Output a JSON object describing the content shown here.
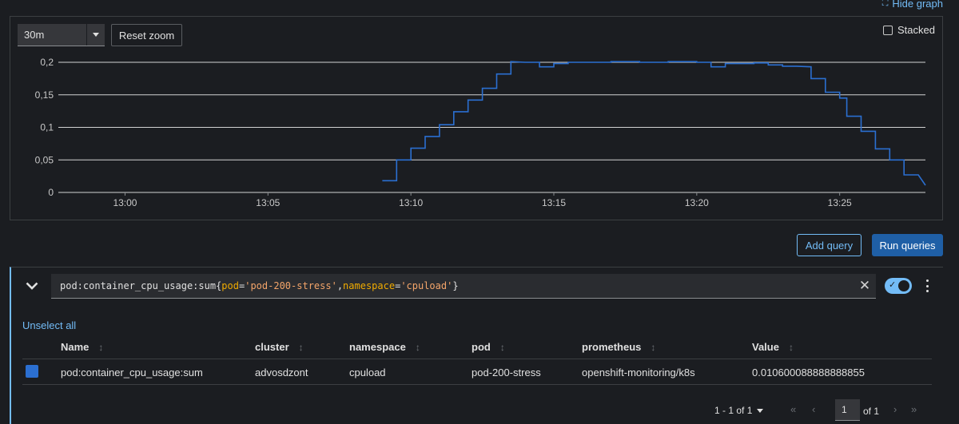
{
  "header": {
    "hide_graph_label": "Hide graph"
  },
  "graph_controls": {
    "time_span": "30m",
    "reset_zoom_label": "Reset zoom",
    "stacked_label": "Stacked",
    "stacked_checked": false
  },
  "chart_data": {
    "type": "line",
    "y_ticks": [
      "0,2",
      "0,15",
      "0,1",
      "0,05",
      "0"
    ],
    "x_ticks": [
      "13:00",
      "13:05",
      "13:10",
      "13:15",
      "13:20",
      "13:25"
    ],
    "ylim": [
      0,
      0.2
    ],
    "xlim_minutes": [
      "12:57:40",
      "13:28:00"
    ],
    "grid": true,
    "series": [
      {
        "color": "#2b6fd1",
        "points": [
          [
            "13:09:00",
            0.018
          ],
          [
            "13:09:30",
            0.018
          ],
          [
            "13:09:30",
            0.05
          ],
          [
            "13:10:00",
            0.05
          ],
          [
            "13:10:00",
            0.068
          ],
          [
            "13:10:30",
            0.068
          ],
          [
            "13:10:30",
            0.086
          ],
          [
            "13:11:00",
            0.086
          ],
          [
            "13:11:00",
            0.104
          ],
          [
            "13:11:30",
            0.104
          ],
          [
            "13:11:30",
            0.124
          ],
          [
            "13:12:00",
            0.124
          ],
          [
            "13:12:00",
            0.142
          ],
          [
            "13:12:30",
            0.142
          ],
          [
            "13:12:30",
            0.16
          ],
          [
            "13:13:00",
            0.16
          ],
          [
            "13:13:00",
            0.182
          ],
          [
            "13:13:30",
            0.182
          ],
          [
            "13:13:30",
            0.201
          ],
          [
            "13:14:00",
            0.2
          ],
          [
            "13:14:30",
            0.2
          ],
          [
            "13:14:30",
            0.193
          ],
          [
            "13:15:00",
            0.193
          ],
          [
            "13:15:00",
            0.198
          ],
          [
            "13:15:30",
            0.198
          ],
          [
            "13:15:30",
            0.2
          ],
          [
            "13:17:00",
            0.2
          ],
          [
            "13:17:00",
            0.201
          ],
          [
            "13:18:00",
            0.201
          ],
          [
            "13:18:00",
            0.2
          ],
          [
            "13:19:00",
            0.2
          ],
          [
            "13:19:00",
            0.201
          ],
          [
            "13:20:00",
            0.201
          ],
          [
            "13:20:00",
            0.2
          ],
          [
            "13:20:30",
            0.2
          ],
          [
            "13:20:30",
            0.193
          ],
          [
            "13:21:00",
            0.193
          ],
          [
            "13:21:00",
            0.198
          ],
          [
            "13:22:00",
            0.198
          ],
          [
            "13:22:00",
            0.199
          ],
          [
            "13:22:30",
            0.199
          ],
          [
            "13:22:30",
            0.196
          ],
          [
            "13:23:00",
            0.196
          ],
          [
            "13:23:00",
            0.194
          ],
          [
            "13:23:30",
            0.194
          ],
          [
            "13:24:00",
            0.193
          ],
          [
            "13:24:00",
            0.175
          ],
          [
            "13:24:30",
            0.175
          ],
          [
            "13:24:30",
            0.154
          ],
          [
            "13:25:00",
            0.154
          ],
          [
            "13:25:00",
            0.145
          ],
          [
            "13:25:15",
            0.145
          ],
          [
            "13:25:15",
            0.117
          ],
          [
            "13:25:45",
            0.117
          ],
          [
            "13:25:45",
            0.094
          ],
          [
            "13:26:15",
            0.094
          ],
          [
            "13:26:15",
            0.067
          ],
          [
            "13:26:45",
            0.067
          ],
          [
            "13:26:45",
            0.05
          ],
          [
            "13:27:15",
            0.05
          ],
          [
            "13:27:15",
            0.027
          ],
          [
            "13:27:45",
            0.027
          ],
          [
            "13:28:00",
            0.011
          ]
        ]
      }
    ]
  },
  "actions": {
    "add_query_label": "Add query",
    "run_queries_label": "Run queries"
  },
  "query": {
    "prefix": "pod:container_cpu_usage:sum{",
    "attr1": "pod",
    "eq1": "=",
    "val1": "'pod-200-stress'",
    "comma": ",",
    "attr2": "namespace",
    "eq2": "=",
    "val2": "'cpuload'",
    "suffix": "}",
    "enabled": true
  },
  "results": {
    "unselect_all_label": "Unselect all",
    "columns": [
      "Name",
      "cluster",
      "namespace",
      "pod",
      "prometheus",
      "Value"
    ],
    "rows": [
      {
        "color": "#2b6fd1",
        "name": "pod:container_cpu_usage:sum",
        "cluster": "advosdzont",
        "namespace": "cpuload",
        "pod": "pod-200-stress",
        "prometheus": "openshift-monitoring/k8s",
        "value": "0.010600088888888855"
      }
    ]
  },
  "pagination": {
    "range": "1 - 1 of 1",
    "page": "1",
    "of_total": "of 1"
  }
}
